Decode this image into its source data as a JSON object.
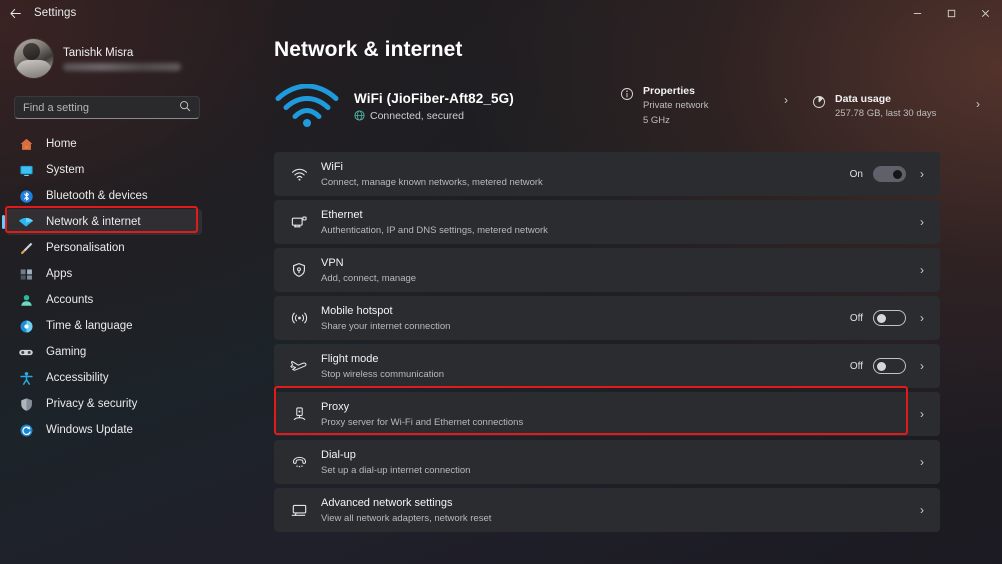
{
  "titlebar": {
    "back_label": "back-arrow",
    "title": "Settings",
    "minimize": "–",
    "maximize": "❐",
    "close": "✕"
  },
  "sidebar": {
    "profile": {
      "name": "Tanishk Misra",
      "email_redacted": ""
    },
    "search": {
      "value": "",
      "placeholder": "Find a setting",
      "icon": "search-icon"
    },
    "items": [
      {
        "label": "Home",
        "icon": "home-icon",
        "active": false
      },
      {
        "label": "System",
        "icon": "system-icon",
        "active": false
      },
      {
        "label": "Bluetooth & devices",
        "icon": "bluetooth-icon",
        "active": false
      },
      {
        "label": "Network & internet",
        "icon": "network-icon",
        "active": true
      },
      {
        "label": "Personalisation",
        "icon": "brush-icon",
        "active": false
      },
      {
        "label": "Apps",
        "icon": "apps-icon",
        "active": false
      },
      {
        "label": "Accounts",
        "icon": "accounts-icon",
        "active": false
      },
      {
        "label": "Time & language",
        "icon": "clock-icon",
        "active": false
      },
      {
        "label": "Gaming",
        "icon": "gamepad-icon",
        "active": false
      },
      {
        "label": "Accessibility",
        "icon": "accessibility-icon",
        "active": false
      },
      {
        "label": "Privacy & security",
        "icon": "shield-icon",
        "active": false
      },
      {
        "label": "Windows Update",
        "icon": "update-icon",
        "active": false
      }
    ]
  },
  "main": {
    "page_title": "Network & internet",
    "hero": {
      "icon": "wifi-icon",
      "name": "WiFi (JioFiber-Aft82_5G)",
      "status": "Connected, secured",
      "status_icon": "globe-icon",
      "cells": [
        {
          "icon": "info-icon",
          "title": "Properties",
          "line1": "Private network",
          "line2": "5 GHz"
        },
        {
          "icon": "pie-chart-icon",
          "title": "Data usage",
          "line1": "257.78 GB, last 30 days",
          "line2": ""
        }
      ]
    },
    "rows": [
      {
        "icon": "wifi-icon",
        "title": "WiFi",
        "sub": "Connect, manage known networks, metered network",
        "toggle": "on",
        "toggle_label": "On"
      },
      {
        "icon": "ethernet-icon",
        "title": "Ethernet",
        "sub": "Authentication, IP and DNS settings, metered network",
        "toggle": null,
        "toggle_label": ""
      },
      {
        "icon": "vpn-shield-icon",
        "title": "VPN",
        "sub": "Add, connect, manage",
        "toggle": null,
        "toggle_label": ""
      },
      {
        "icon": "hotspot-icon",
        "title": "Mobile hotspot",
        "sub": "Share your internet connection",
        "toggle": "off",
        "toggle_label": "Off"
      },
      {
        "icon": "airplane-icon",
        "title": "Flight mode",
        "sub": "Stop wireless communication",
        "toggle": "off",
        "toggle_label": "Off"
      },
      {
        "icon": "proxy-icon",
        "title": "Proxy",
        "sub": "Proxy server for Wi-Fi and Ethernet connections",
        "toggle": null,
        "toggle_label": ""
      },
      {
        "icon": "dialup-icon",
        "title": "Dial-up",
        "sub": "Set up a dial-up internet connection",
        "toggle": null,
        "toggle_label": ""
      },
      {
        "icon": "advanced-network-icon",
        "title": "Advanced network settings",
        "sub": "View all network adapters, network reset",
        "toggle": null,
        "toggle_label": ""
      }
    ],
    "chevron": "›"
  },
  "annotations": {
    "highlight_color": "#e01b1b",
    "boxes": [
      {
        "target": "sidebar-item-network-internet"
      },
      {
        "target": "settings-row-proxy"
      }
    ]
  },
  "colors": {
    "accent": "#60cdff",
    "card": "#2b2c30",
    "wifi_blue": "#1f9bdd",
    "connected_green": "#4fb9a8"
  }
}
